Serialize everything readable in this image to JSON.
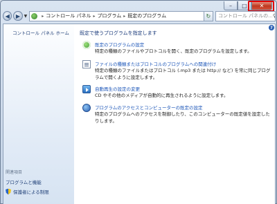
{
  "window": {
    "minimize_glyph": "–",
    "maximize_glyph": "□",
    "close_glyph": "✕"
  },
  "nav": {
    "back_glyph": "◀",
    "forward_glyph": "▶",
    "address_crumbs": [
      "コントロール パネル",
      "プログラム",
      "既定のプログラム"
    ],
    "crumb_separator": "▸",
    "refresh_glyph": "↻",
    "search_placeholder": "コントロール パネルの..."
  },
  "sidebar": {
    "home": "コントロール パネル ホーム",
    "related_heading": "関連項目",
    "links": [
      "プログラムと機能",
      "保護者による制限"
    ]
  },
  "main": {
    "title": "既定で使うプログラムを指定します",
    "items": [
      {
        "icon": "default-programs-icon",
        "link": "既定のプログラムの設定",
        "desc": "特定の種類のファイルやプロトコルを開く、既定のプログラムを設定します。"
      },
      {
        "icon": "file-association-icon",
        "link": "ファイルの種類またはプロトコルのプログラムへの関連付け",
        "desc": "特定の種類のファイルまたはプロトコル (.mp3 または http:// など) を常に同じプログラムで開くように設定します。"
      },
      {
        "icon": "autoplay-icon",
        "link": "自動再生の設定の変更",
        "desc": "CD やその他のメディアが自動的に再生されるように設定します。"
      },
      {
        "icon": "program-access-icon",
        "link": "プログラムのアクセスとコンピューターの既定の設定",
        "desc": "特定のプログラムへのアクセスを制御したり、このコンピューターの既定値を設定したりします。"
      }
    ]
  },
  "colors": {
    "link": "#1c56b8",
    "title": "#1a3a7a",
    "highlight_box": "#e00000"
  }
}
